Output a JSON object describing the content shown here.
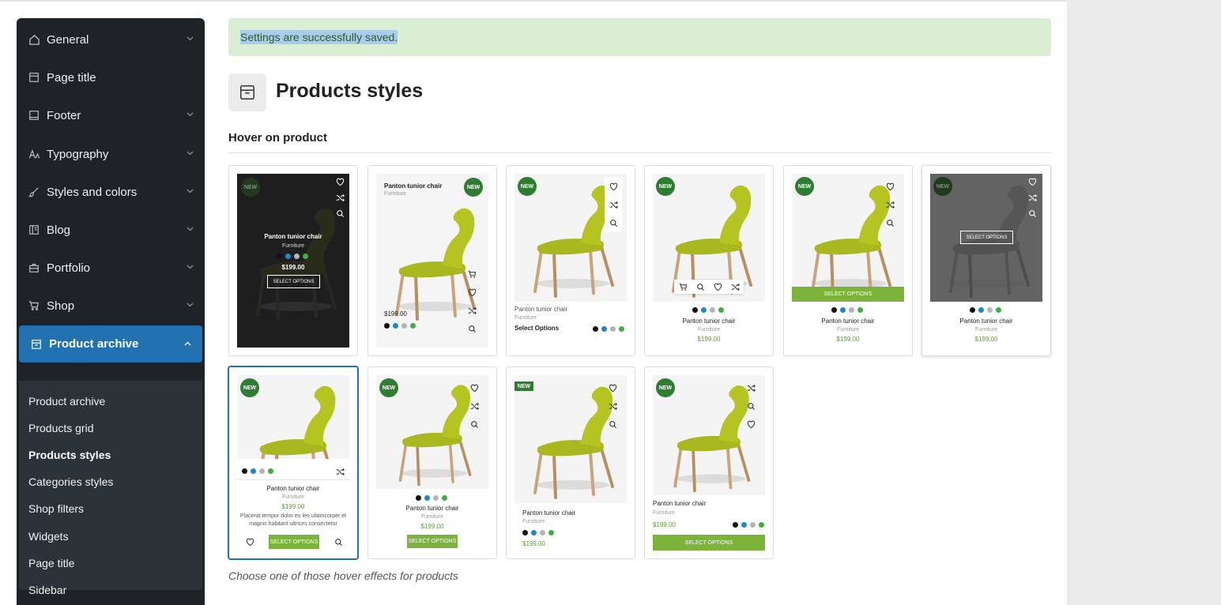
{
  "sidebar": {
    "items": [
      {
        "label": "General",
        "icon": "home-icon"
      },
      {
        "label": "Page title",
        "icon": "page-icon"
      },
      {
        "label": "Footer",
        "icon": "footer-icon"
      },
      {
        "label": "Typography",
        "icon": "typography-icon"
      },
      {
        "label": "Styles and colors",
        "icon": "brush-icon"
      },
      {
        "label": "Blog",
        "icon": "blog-icon"
      },
      {
        "label": "Portfolio",
        "icon": "briefcase-icon"
      },
      {
        "label": "Shop",
        "icon": "cart-icon"
      },
      {
        "label": "Product archive",
        "icon": "archive-icon"
      }
    ],
    "subitems": [
      "Product archive",
      "Products grid",
      "Products styles",
      "Categories styles",
      "Shop filters",
      "Widgets",
      "Page title",
      "Sidebar"
    ]
  },
  "notice": "Settings are successfully saved.",
  "heading": "Products styles",
  "subhead": "Hover on product",
  "help": "Choose one of those hover effects for products",
  "product": {
    "name": "Panton tunior chair",
    "category": "Furniture",
    "price": "$199.00",
    "badge": "NEW",
    "select": "SELECT OPTIONS",
    "select_text": "Select Options",
    "description": "Placerat tempor dolor eu leo ullamcorper et magnis habitant ultrices consectetur",
    "swatches": [
      "#111111",
      "#1e88c8",
      "#b5b5b5",
      "#3fae3f"
    ]
  },
  "colors": {
    "sidebar_bg": "#1d2327",
    "accent": "#2271b1",
    "green": "#7cb33a",
    "badge_green": "#2e7d32"
  }
}
